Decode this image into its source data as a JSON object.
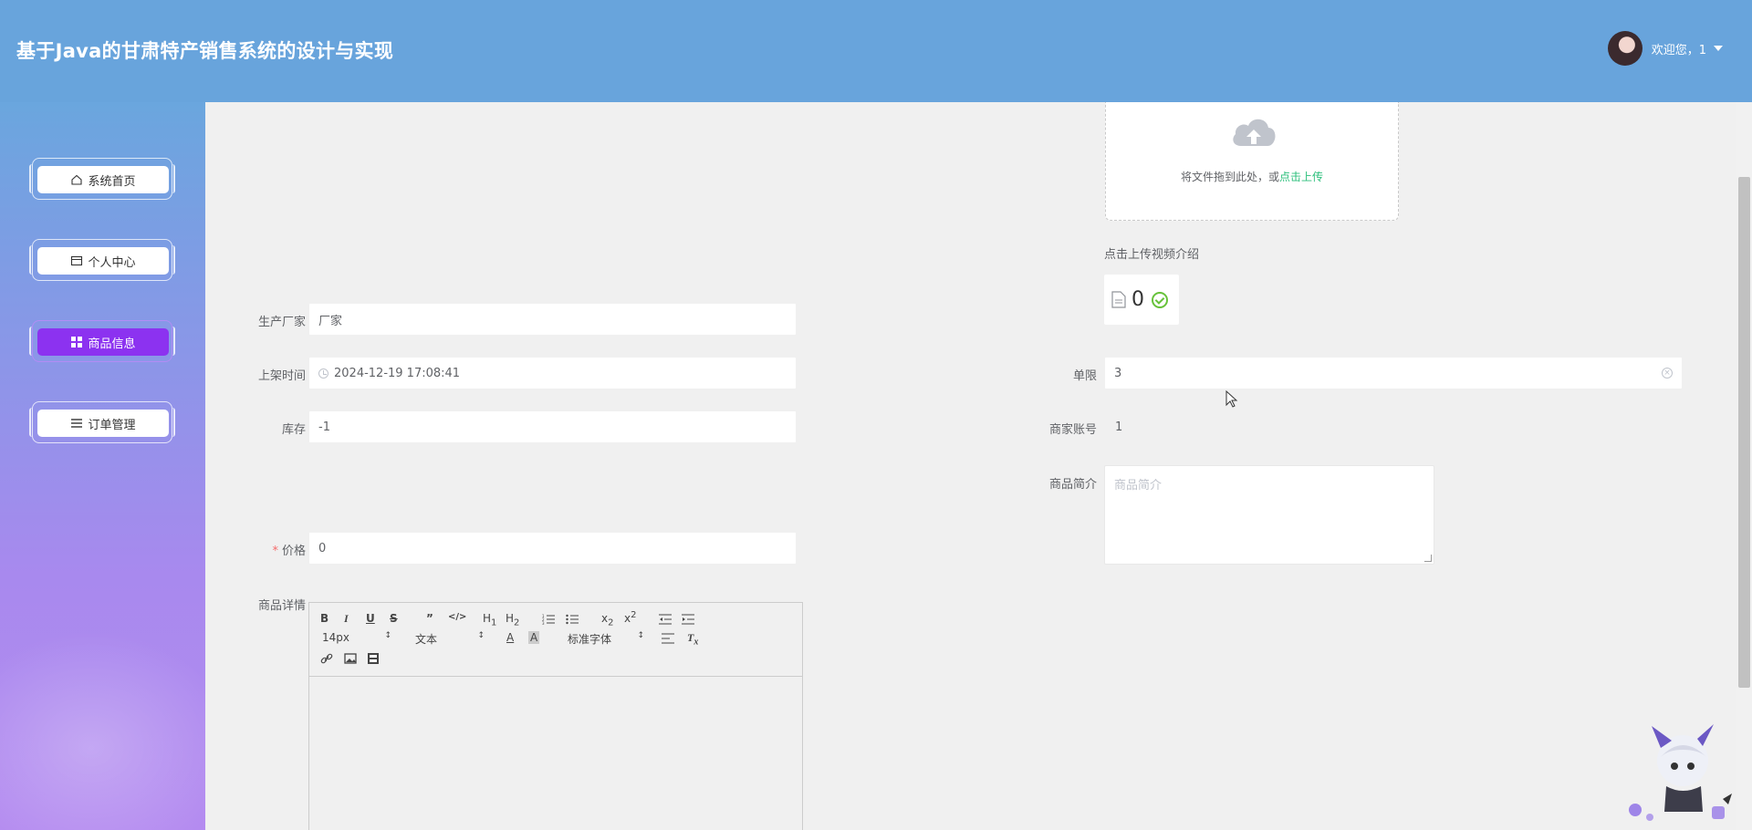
{
  "header": {
    "title": "基于Java的甘肃特产销售系统的设计与实现",
    "welcome": "欢迎您，1"
  },
  "sidebar": {
    "items": [
      {
        "label": "系统首页",
        "icon": "home-icon",
        "active": false
      },
      {
        "label": "个人中心",
        "icon": "profile-icon",
        "active": false
      },
      {
        "label": "商品信息",
        "icon": "grid-icon",
        "active": true
      },
      {
        "label": "订单管理",
        "icon": "list-icon",
        "active": false
      }
    ]
  },
  "upload": {
    "text": "将文件拖到此处，或",
    "link": "点击上传",
    "video_label": "点击上传视频介绍",
    "file_count": "0"
  },
  "form": {
    "manufacturer": {
      "label": "生产厂家",
      "value": "厂家"
    },
    "shelf_time": {
      "label": "上架时间",
      "value": "2024-12-19 17:08:41"
    },
    "stock": {
      "label": "库存",
      "value": "-1"
    },
    "price": {
      "label": "价格",
      "required_mark": "*",
      "value": "0"
    },
    "detail": {
      "label": "商品详情"
    },
    "limit": {
      "label": "单限",
      "value": "3"
    },
    "merchant_account": {
      "label": "商家账号",
      "value": "1"
    },
    "intro": {
      "label": "商品简介",
      "placeholder": "商品简介"
    }
  },
  "editor": {
    "font_size": "14px",
    "block_type": "文本",
    "font_family": "标准字体",
    "buttons": [
      "B",
      "I",
      "U",
      "S",
      "99",
      "</>",
      "H1",
      "H2",
      "ol",
      "ul",
      "x2",
      "x²",
      "outdent",
      "indent"
    ]
  }
}
